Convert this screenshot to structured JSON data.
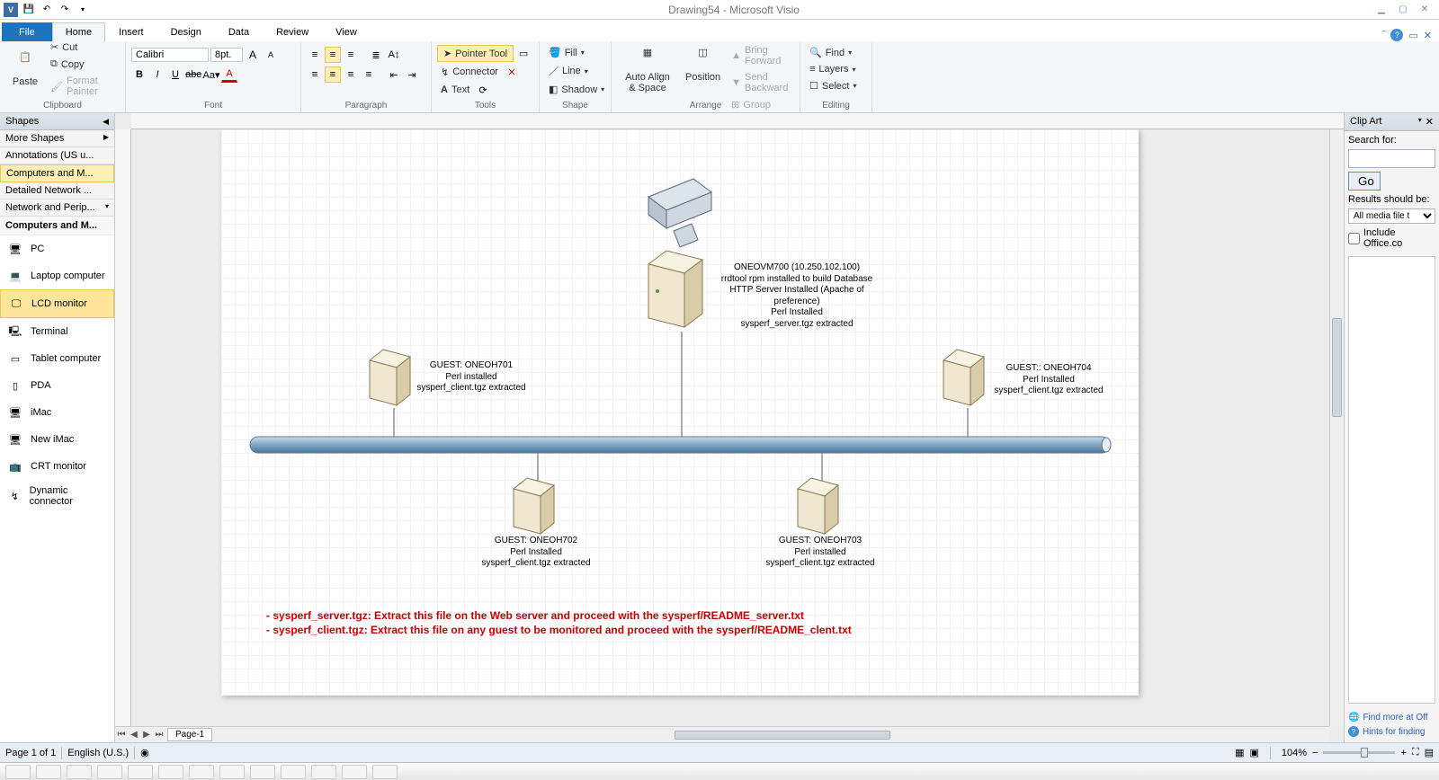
{
  "title": "Drawing54 - Microsoft Visio",
  "tabs": {
    "file": "File",
    "home": "Home",
    "insert": "Insert",
    "design": "Design",
    "data": "Data",
    "review": "Review",
    "view": "View"
  },
  "clipboard": {
    "paste": "Paste",
    "cut": "Cut",
    "copy": "Copy",
    "format_painter": "Format Painter",
    "label": "Clipboard"
  },
  "font": {
    "name": "Calibri",
    "size": "8pt.",
    "label": "Font"
  },
  "paragraph": {
    "label": "Paragraph"
  },
  "tools": {
    "pointer": "Pointer Tool",
    "connector": "Connector",
    "text": "Text",
    "label": "Tools"
  },
  "shape": {
    "fill": "Fill",
    "line": "Line",
    "shadow": "Shadow",
    "label": "Shape"
  },
  "arrange": {
    "autoalign": "Auto Align & Space",
    "position": "Position",
    "bring": "Bring Forward",
    "send": "Send Backward",
    "group": "Group",
    "label": "Arrange"
  },
  "editing": {
    "find": "Find",
    "layers": "Layers",
    "select": "Select",
    "label": "Editing"
  },
  "shapes_pane": {
    "title": "Shapes",
    "more": "More Shapes",
    "stencils": [
      "Annotations (US u...",
      "Computers and M...",
      "Detailed Network ...",
      "Network and Perip..."
    ],
    "active_stencil": "Computers and M...",
    "subheader": "Computers and M...",
    "items": [
      "PC",
      "Laptop computer",
      "LCD monitor",
      "Terminal",
      "Tablet computer",
      "PDA",
      "iMac",
      "New iMac",
      "CRT monitor",
      "Dynamic connector"
    ],
    "selected": "LCD monitor"
  },
  "clipart": {
    "title": "Clip Art",
    "search_for": "Search for:",
    "go": "Go",
    "results_should_be": "Results should be:",
    "media_type": "All media file t",
    "include_office": "Include Office.co",
    "find_more": "Find more at Off",
    "hints": "Hints for finding"
  },
  "diagram": {
    "server_main": "ONEOVM700 (10.250.102.100)\nrrdtool rpm installed to build Database\nHTTP Server Installed (Apache of preference)\nPerl Installed\nsysperf_server.tgz extracted",
    "guest701": "GUEST: ONEOH701\nPerl installed\nsysperf_client.tgz extracted",
    "guest702": "GUEST: ONEOH702\nPerl Installed\nsysperf_client.tgz extracted",
    "guest703": "GUEST: ONEOH703\nPerl installed\nsysperf_client.tgz extracted",
    "guest704": "GUEST:: ONEOH704\nPerl Installed\nsysperf_client.tgz extracted",
    "note1": "- sysperf_server.tgz: Extract this file on the Web server and proceed with the sysperf/README_server.txt",
    "note2": "- sysperf_client.tgz: Extract this file on any guest to be monitored and proceed with the   sysperf/README_clent.txt"
  },
  "status": {
    "page": "Page 1 of 1",
    "lang": "English (U.S.)",
    "zoom": "104%"
  },
  "page_tab": "Page-1"
}
